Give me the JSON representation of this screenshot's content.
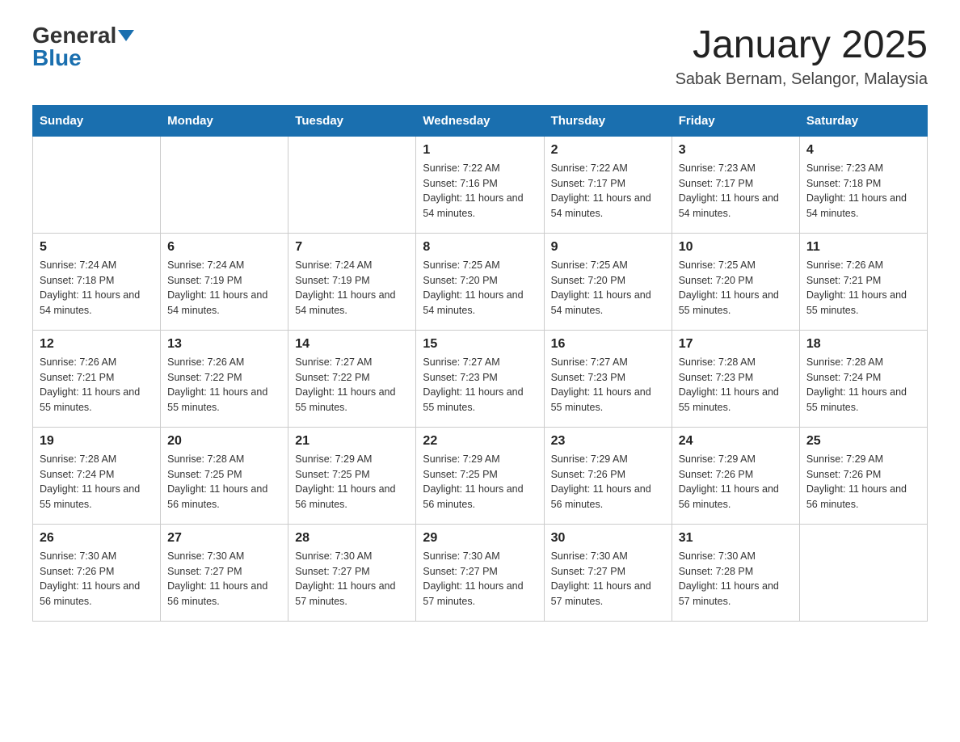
{
  "header": {
    "logo_general": "General",
    "logo_blue": "Blue",
    "month_title": "January 2025",
    "location": "Sabak Bernam, Selangor, Malaysia"
  },
  "weekdays": [
    "Sunday",
    "Monday",
    "Tuesday",
    "Wednesday",
    "Thursday",
    "Friday",
    "Saturday"
  ],
  "weeks": [
    [
      {
        "day": "",
        "info": ""
      },
      {
        "day": "",
        "info": ""
      },
      {
        "day": "",
        "info": ""
      },
      {
        "day": "1",
        "info": "Sunrise: 7:22 AM\nSunset: 7:16 PM\nDaylight: 11 hours and 54 minutes."
      },
      {
        "day": "2",
        "info": "Sunrise: 7:22 AM\nSunset: 7:17 PM\nDaylight: 11 hours and 54 minutes."
      },
      {
        "day": "3",
        "info": "Sunrise: 7:23 AM\nSunset: 7:17 PM\nDaylight: 11 hours and 54 minutes."
      },
      {
        "day": "4",
        "info": "Sunrise: 7:23 AM\nSunset: 7:18 PM\nDaylight: 11 hours and 54 minutes."
      }
    ],
    [
      {
        "day": "5",
        "info": "Sunrise: 7:24 AM\nSunset: 7:18 PM\nDaylight: 11 hours and 54 minutes."
      },
      {
        "day": "6",
        "info": "Sunrise: 7:24 AM\nSunset: 7:19 PM\nDaylight: 11 hours and 54 minutes."
      },
      {
        "day": "7",
        "info": "Sunrise: 7:24 AM\nSunset: 7:19 PM\nDaylight: 11 hours and 54 minutes."
      },
      {
        "day": "8",
        "info": "Sunrise: 7:25 AM\nSunset: 7:20 PM\nDaylight: 11 hours and 54 minutes."
      },
      {
        "day": "9",
        "info": "Sunrise: 7:25 AM\nSunset: 7:20 PM\nDaylight: 11 hours and 54 minutes."
      },
      {
        "day": "10",
        "info": "Sunrise: 7:25 AM\nSunset: 7:20 PM\nDaylight: 11 hours and 55 minutes."
      },
      {
        "day": "11",
        "info": "Sunrise: 7:26 AM\nSunset: 7:21 PM\nDaylight: 11 hours and 55 minutes."
      }
    ],
    [
      {
        "day": "12",
        "info": "Sunrise: 7:26 AM\nSunset: 7:21 PM\nDaylight: 11 hours and 55 minutes."
      },
      {
        "day": "13",
        "info": "Sunrise: 7:26 AM\nSunset: 7:22 PM\nDaylight: 11 hours and 55 minutes."
      },
      {
        "day": "14",
        "info": "Sunrise: 7:27 AM\nSunset: 7:22 PM\nDaylight: 11 hours and 55 minutes."
      },
      {
        "day": "15",
        "info": "Sunrise: 7:27 AM\nSunset: 7:23 PM\nDaylight: 11 hours and 55 minutes."
      },
      {
        "day": "16",
        "info": "Sunrise: 7:27 AM\nSunset: 7:23 PM\nDaylight: 11 hours and 55 minutes."
      },
      {
        "day": "17",
        "info": "Sunrise: 7:28 AM\nSunset: 7:23 PM\nDaylight: 11 hours and 55 minutes."
      },
      {
        "day": "18",
        "info": "Sunrise: 7:28 AM\nSunset: 7:24 PM\nDaylight: 11 hours and 55 minutes."
      }
    ],
    [
      {
        "day": "19",
        "info": "Sunrise: 7:28 AM\nSunset: 7:24 PM\nDaylight: 11 hours and 55 minutes."
      },
      {
        "day": "20",
        "info": "Sunrise: 7:28 AM\nSunset: 7:25 PM\nDaylight: 11 hours and 56 minutes."
      },
      {
        "day": "21",
        "info": "Sunrise: 7:29 AM\nSunset: 7:25 PM\nDaylight: 11 hours and 56 minutes."
      },
      {
        "day": "22",
        "info": "Sunrise: 7:29 AM\nSunset: 7:25 PM\nDaylight: 11 hours and 56 minutes."
      },
      {
        "day": "23",
        "info": "Sunrise: 7:29 AM\nSunset: 7:26 PM\nDaylight: 11 hours and 56 minutes."
      },
      {
        "day": "24",
        "info": "Sunrise: 7:29 AM\nSunset: 7:26 PM\nDaylight: 11 hours and 56 minutes."
      },
      {
        "day": "25",
        "info": "Sunrise: 7:29 AM\nSunset: 7:26 PM\nDaylight: 11 hours and 56 minutes."
      }
    ],
    [
      {
        "day": "26",
        "info": "Sunrise: 7:30 AM\nSunset: 7:26 PM\nDaylight: 11 hours and 56 minutes."
      },
      {
        "day": "27",
        "info": "Sunrise: 7:30 AM\nSunset: 7:27 PM\nDaylight: 11 hours and 56 minutes."
      },
      {
        "day": "28",
        "info": "Sunrise: 7:30 AM\nSunset: 7:27 PM\nDaylight: 11 hours and 57 minutes."
      },
      {
        "day": "29",
        "info": "Sunrise: 7:30 AM\nSunset: 7:27 PM\nDaylight: 11 hours and 57 minutes."
      },
      {
        "day": "30",
        "info": "Sunrise: 7:30 AM\nSunset: 7:27 PM\nDaylight: 11 hours and 57 minutes."
      },
      {
        "day": "31",
        "info": "Sunrise: 7:30 AM\nSunset: 7:28 PM\nDaylight: 11 hours and 57 minutes."
      },
      {
        "day": "",
        "info": ""
      }
    ]
  ]
}
